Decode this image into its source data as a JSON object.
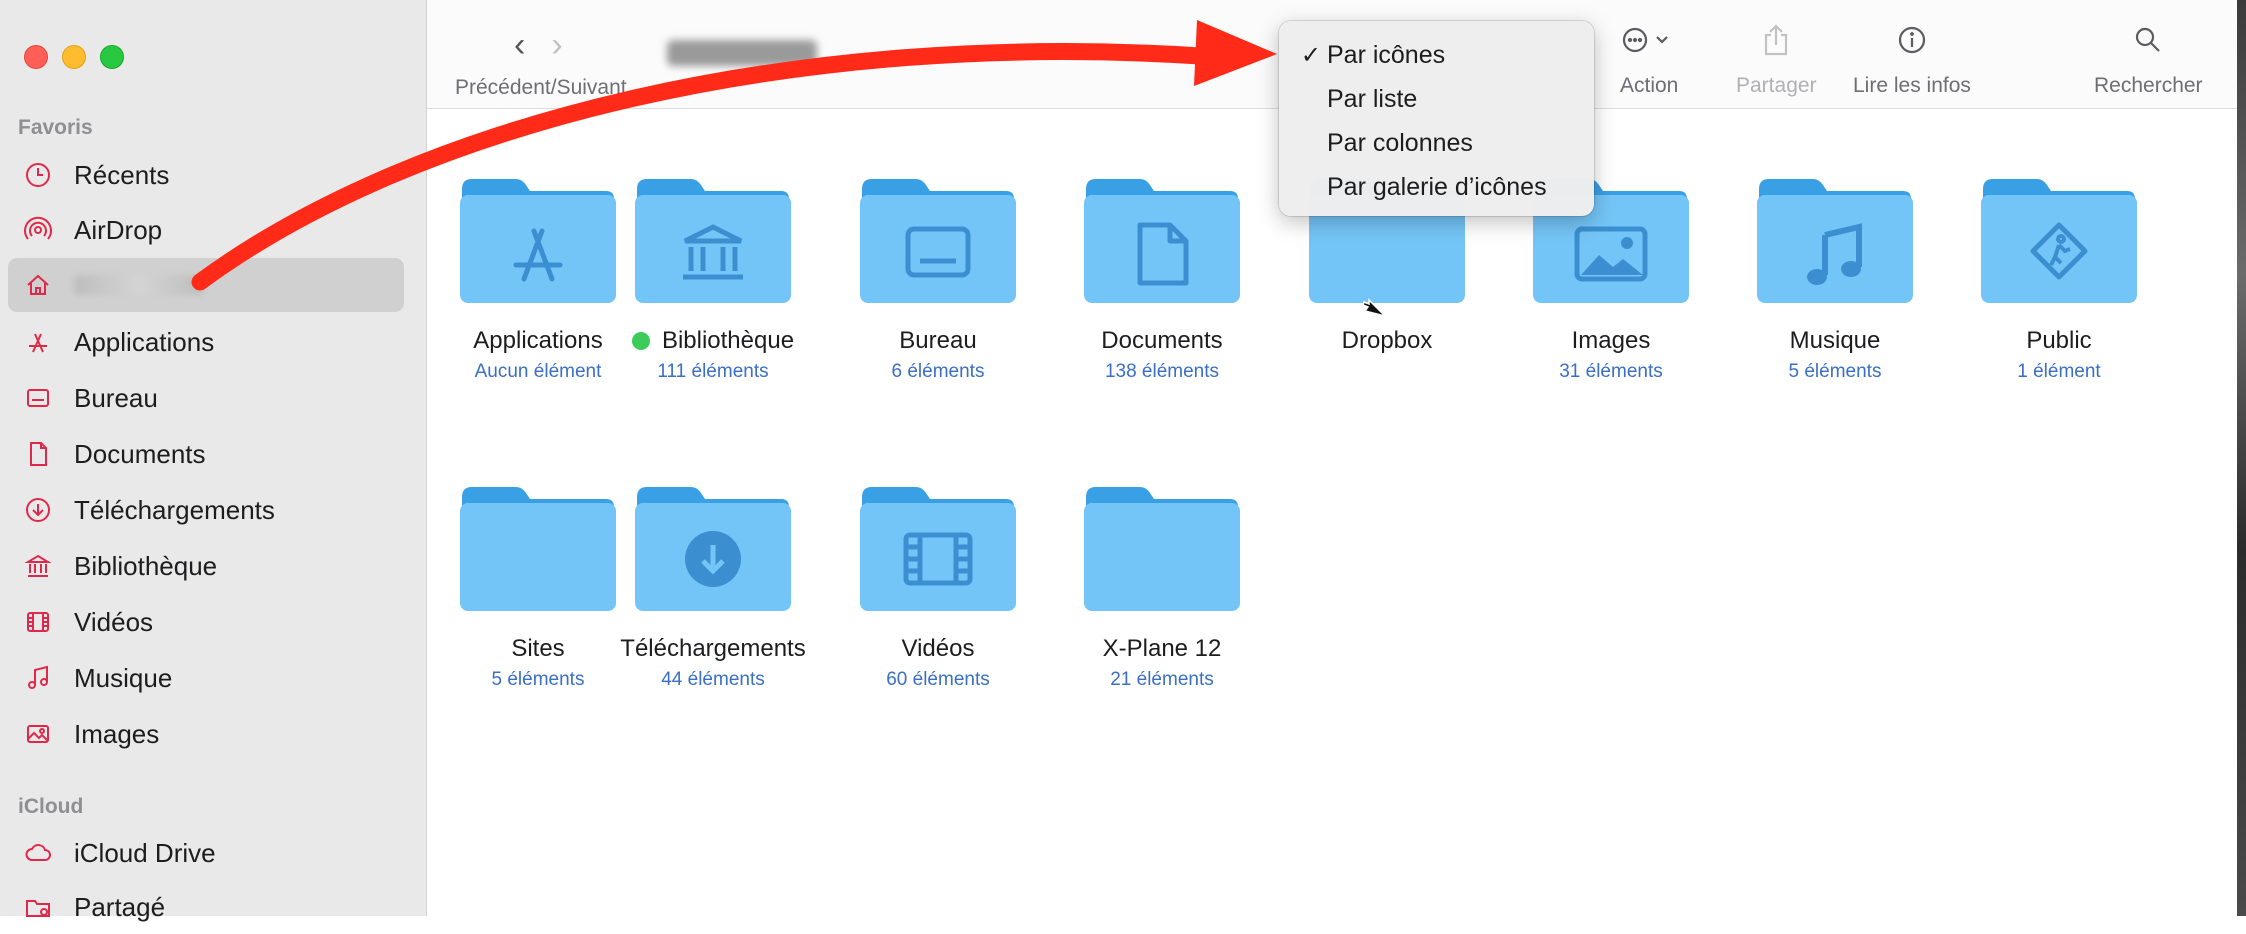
{
  "colors": {
    "accent": "#e0294a",
    "folder_body": "#74c5f7",
    "folder_tab": "#3aa0e6",
    "count_text": "#3a6fc4",
    "tag_green": "#3ccc5a",
    "annotation_arrow": "#ff2a17"
  },
  "sidebar": {
    "sections": [
      {
        "title": "Favoris",
        "items": [
          {
            "label": "Récents",
            "icon": "clock-icon"
          },
          {
            "label": "AirDrop",
            "icon": "airdrop-icon"
          },
          {
            "label": "",
            "icon": "home-icon",
            "selected": true
          },
          {
            "label": "Applications",
            "icon": "applications-icon"
          },
          {
            "label": "Bureau",
            "icon": "desktop-icon"
          },
          {
            "label": "Documents",
            "icon": "document-icon"
          },
          {
            "label": "Téléchargements",
            "icon": "download-icon"
          },
          {
            "label": "Bibliothèque",
            "icon": "library-icon"
          },
          {
            "label": "Vidéos",
            "icon": "film-icon"
          },
          {
            "label": "Musique",
            "icon": "music-icon"
          },
          {
            "label": "Images",
            "icon": "photo-icon"
          }
        ]
      },
      {
        "title": "iCloud",
        "items": [
          {
            "label": "iCloud Drive",
            "icon": "cloud-icon"
          },
          {
            "label": "Partagé",
            "icon": "shared-folder-icon"
          }
        ]
      }
    ]
  },
  "toolbar": {
    "nav_label": "Précédent/Suivant",
    "action_label": "Action",
    "share_label": "Partager",
    "info_label": "Lire les infos",
    "search_label": "Rechercher"
  },
  "view_menu": {
    "items": [
      {
        "label": "Par icônes",
        "checked": true
      },
      {
        "label": "Par liste",
        "checked": false
      },
      {
        "label": "Par colonnes",
        "checked": false
      },
      {
        "label": "Par galerie d’icônes",
        "checked": false
      }
    ],
    "check_mark": "✓"
  },
  "folders": [
    {
      "name": "Applications",
      "count": "Aucun élément",
      "glyph": "applications-icon"
    },
    {
      "name": "Bibliothèque",
      "count": "111 éléments",
      "glyph": "library-icon",
      "tag": "green"
    },
    {
      "name": "Bureau",
      "count": "6 éléments",
      "glyph": "desktop-icon"
    },
    {
      "name": "Documents",
      "count": "138 éléments",
      "glyph": "document-icon"
    },
    {
      "name": "Dropbox",
      "count": "",
      "glyph": "none"
    },
    {
      "name": "Images",
      "count": "31 éléments",
      "glyph": "photo-icon"
    },
    {
      "name": "Musique",
      "count": "5 éléments",
      "glyph": "music-icon"
    },
    {
      "name": "Public",
      "count": "1 élément",
      "glyph": "public-icon"
    },
    {
      "name": "Sites",
      "count": "5 éléments",
      "glyph": "none"
    },
    {
      "name": "Téléchargements",
      "count": "44 éléments",
      "glyph": "download-icon"
    },
    {
      "name": "Vidéos",
      "count": "60 éléments",
      "glyph": "film-icon"
    },
    {
      "name": "X-Plane 12",
      "count": "21 éléments",
      "glyph": "none"
    }
  ]
}
